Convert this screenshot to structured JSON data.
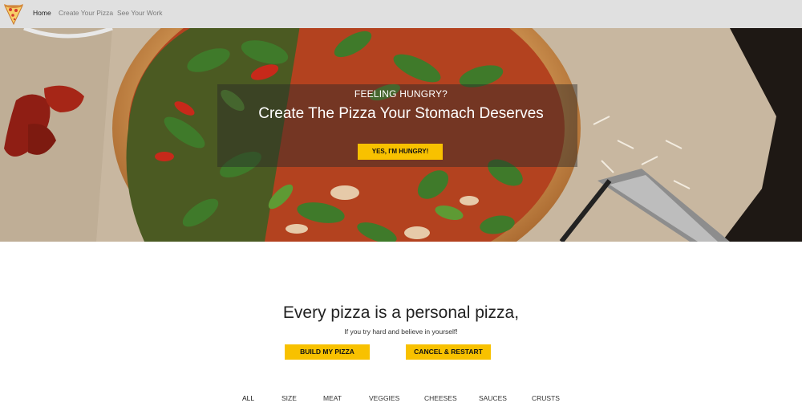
{
  "nav": {
    "links": [
      "Home",
      "Create Your Pizza",
      "See Your Work"
    ]
  },
  "hero": {
    "eyebrow": "Feeling Hungry?",
    "title": "Create The Pizza Your Stomach Deserves",
    "cta_label": "Yes, I'm Hungry!"
  },
  "intro": {
    "headline": "Every pizza is a personal pizza,",
    "subline": "If you try hard and believe in yourself!",
    "build_label": "Build My Pizza",
    "cancel_label": "Cancel & Restart"
  },
  "filters": [
    "All",
    "Size",
    "Meat",
    "Veggies",
    "Cheeses",
    "Sauces",
    "Crusts"
  ],
  "colors": {
    "navbar_bg": "#e0e0e0",
    "accent": "#f8c100",
    "active_link": "#222222",
    "inactive_link": "#7a7a7a"
  },
  "icons": {
    "brand": "pizza-slice-icon"
  }
}
